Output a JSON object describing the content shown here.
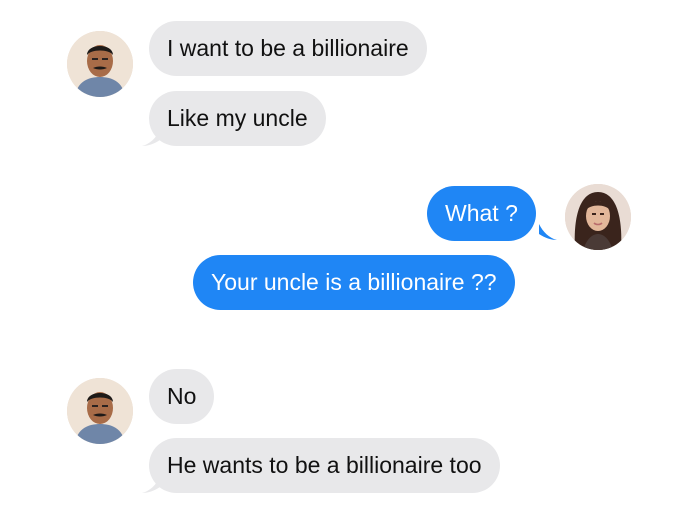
{
  "conversation": {
    "messages": [
      {
        "sender": "contact",
        "text": "I want to be a billionaire"
      },
      {
        "sender": "contact",
        "text": "Like my uncle"
      },
      {
        "sender": "me",
        "text": "What ?"
      },
      {
        "sender": "me",
        "text": "Your uncle is a billionaire ??"
      },
      {
        "sender": "contact",
        "text": "No"
      },
      {
        "sender": "contact",
        "text": "He wants to be a billionaire too"
      }
    ]
  },
  "colors": {
    "incoming_bubble": "#e8e8ea",
    "outgoing_bubble": "#1f86f5",
    "outgoing_text": "#ffffff",
    "incoming_text": "#111111"
  },
  "icons": {
    "contact_avatar": "contact-avatar-icon",
    "my_avatar": "my-avatar-icon"
  }
}
